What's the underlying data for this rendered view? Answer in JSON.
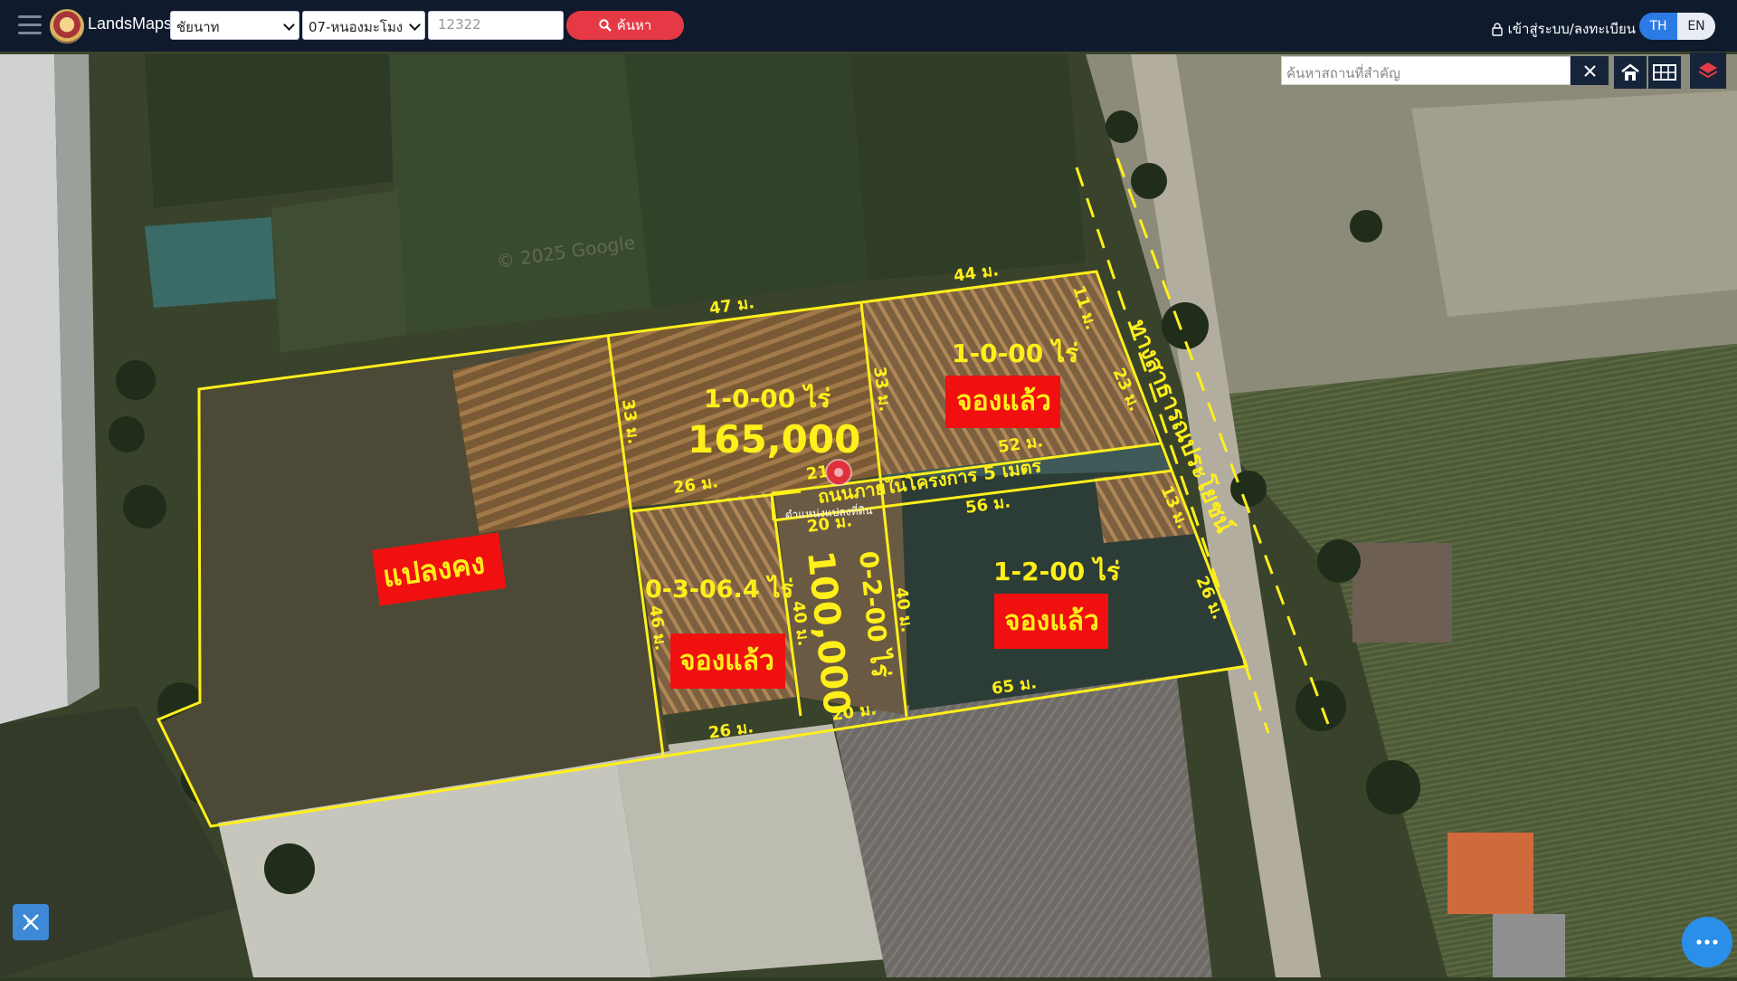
{
  "header": {
    "brand": "LandsMaps",
    "province": "ชัยนาท",
    "district": "07-หนองมะโมง",
    "parcel_number": "12322",
    "search_label": "ค้นหา",
    "login_label": "เข้าสู่ระบบ/ลงทะเบียน",
    "lang_th": "TH",
    "lang_en": "EN"
  },
  "map": {
    "place_search_placeholder": "ค้นหาสถานที่สำคัญ",
    "watermark": "© 2025 Google",
    "plots": {
      "plot1_area": "1-0-00 ไร่",
      "plot1_price": "165,000",
      "plot2_area": "1-0-00 ไร่",
      "plot2_status": "จองแล้ว",
      "plot3_area": "0-3-06.4 ไร่",
      "plot3_status": "จองแล้ว",
      "plot4_area": "0-2-00 ไร่",
      "plot4_price": "100,000",
      "plot5_area": "1-2-00 ไร่",
      "plot5_status": "จองแล้ว",
      "remaining": "แปลงคง"
    },
    "road_label": "ถนนภายในโครงการ 5 เมตร",
    "public_road": "ทางสาธารณประโยชน์",
    "small_text": "ตำแหน่งแปลงที่ดิน",
    "dims": {
      "d44": "44 ม.",
      "d47": "47 ม.",
      "d11": "11 ม.",
      "d33a": "33 ม.",
      "d33b": "33 ม.",
      "d23": "23 ม.",
      "d52": "52 ม.",
      "d26a": "26 ม.",
      "d21": "21 ม.",
      "d56": "56 ม.",
      "d13": "13 ม.",
      "d20a": "20 ม.",
      "d40a": "40 ม.",
      "d40b": "40 ม.",
      "d46": "46 ม.",
      "d26b": "26 ม.",
      "d26c": "26 ม.",
      "d20b": "20 ม.",
      "d65": "65 ม."
    }
  },
  "colors": {
    "topbar": "#0f1a2c",
    "accent_red": "#e53945",
    "lang_active": "#2c7be5",
    "boundary": "#ffef1a",
    "tag_red": "#f01010"
  }
}
